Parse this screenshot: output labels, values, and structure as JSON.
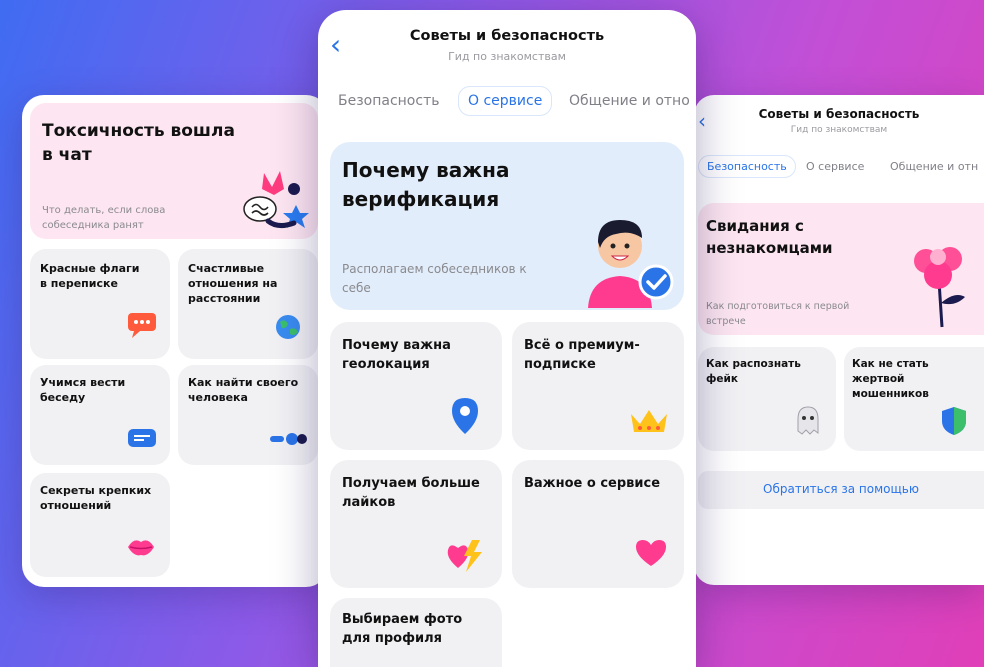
{
  "left_screen": {
    "hero": {
      "title": "Токсичность вошла в чат",
      "subtitle": "Что делать, если слова собеседника ранят"
    },
    "cards": [
      {
        "title": "Красные флаги в переписке",
        "icon": "speech-bubble-icon"
      },
      {
        "title": "Счастливые отношения на расстоянии",
        "icon": "globe-icon"
      },
      {
        "title": "Учимся вести беседу",
        "icon": "chat-bubble-icon"
      },
      {
        "title": "Как найти своего человека",
        "icon": "binoculars-icon"
      },
      {
        "title": "Секреты крепких отношений",
        "icon": "lips-icon"
      }
    ]
  },
  "center_screen": {
    "header": {
      "title": "Советы и безопасность",
      "subtitle": "Гид по знакомствам"
    },
    "tabs": [
      {
        "label": "Безопасность"
      },
      {
        "label": "О сервисе",
        "active": true
      },
      {
        "label": "Общение и отно"
      }
    ],
    "hero": {
      "title": "Почему важна верификация",
      "subtitle": "Располагаем собеседников к себе"
    },
    "cards": [
      {
        "title": "Почему важна геолокация",
        "icon": "location-pin-icon"
      },
      {
        "title": "Всё о премиум-подписке",
        "icon": "crown-icon"
      },
      {
        "title": "Получаем больше лайков",
        "icon": "heart-lightning-icon"
      },
      {
        "title": "Важное о сервисе",
        "icon": "heart-icon"
      },
      {
        "title": "Выбираем фото для профиля",
        "icon": ""
      }
    ]
  },
  "right_screen": {
    "header": {
      "title": "Советы и безопасность",
      "subtitle": "Гид по знакомствам"
    },
    "tabs": [
      {
        "label": "Безопасность",
        "active": true
      },
      {
        "label": "О сервисе"
      },
      {
        "label": "Общение и отн"
      }
    ],
    "hero": {
      "title": "Свидания с незнакомцами",
      "subtitle": "Как подготовиться к первой встрече"
    },
    "cards": [
      {
        "title": "Как распознать фейк",
        "icon": "ghost-icon"
      },
      {
        "title": "Как не стать жертвой мошенников",
        "icon": "shield-icon"
      }
    ],
    "help_button": "Обратиться за помощью"
  },
  "colors": {
    "accent": "#2a74e8",
    "hero_pink": "#fde6f1",
    "hero_blue": "#e2edfb",
    "card_bg": "#f1f1f4"
  }
}
